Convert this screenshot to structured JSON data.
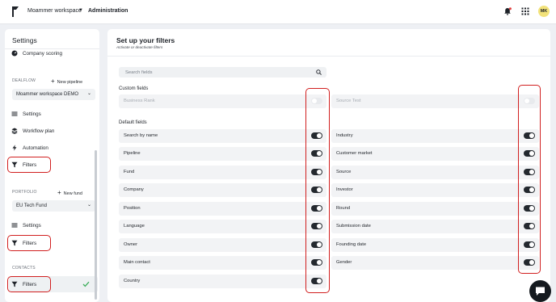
{
  "topbar": {
    "workspace": "Moammer workspace",
    "section": "Administration",
    "avatar": "MK"
  },
  "sidebar": {
    "title": "Settings",
    "company_scoring": "Company scoring",
    "dealflow_label": "DEALFLOW",
    "new_pipeline": "New pipeline",
    "pipeline_select": "Moammer workspace DEMO",
    "pipeline_items": [
      "Settings",
      "Workflow plan",
      "Automation",
      "Filters"
    ],
    "portfolio_label": "PORTFOLIO",
    "new_fund": "New fund",
    "fund_select": "EU Tech Fund",
    "portfolio_items": [
      "Settings",
      "Filters"
    ],
    "contacts_label": "CONTACTS",
    "contacts_filters": "Filters"
  },
  "main": {
    "title": "Set up your filters",
    "subtitle": "Activate or deactivate filters",
    "search_placeholder": "Search fields",
    "custom_label": "Custom fields",
    "default_label": "Default fields",
    "custom_fields": [
      {
        "label": "Business Rank",
        "enabled": false
      },
      {
        "label": "Source Test",
        "enabled": false
      }
    ],
    "default_left": [
      {
        "label": "Search by name",
        "enabled": true
      },
      {
        "label": "Pipeline",
        "enabled": true
      },
      {
        "label": "Fund",
        "enabled": true
      },
      {
        "label": "Company",
        "enabled": true
      },
      {
        "label": "Position",
        "enabled": true
      },
      {
        "label": "Language",
        "enabled": true
      },
      {
        "label": "Owner",
        "enabled": true
      },
      {
        "label": "Main contact",
        "enabled": true
      },
      {
        "label": "Country",
        "enabled": true
      }
    ],
    "default_right": [
      {
        "label": "Industry",
        "enabled": true
      },
      {
        "label": "Customer market",
        "enabled": true
      },
      {
        "label": "Source",
        "enabled": true
      },
      {
        "label": "Investor",
        "enabled": true
      },
      {
        "label": "Round",
        "enabled": true
      },
      {
        "label": "Submission date",
        "enabled": true
      },
      {
        "label": "Founding date",
        "enabled": true
      },
      {
        "label": "Gender",
        "enabled": true
      }
    ]
  },
  "colors": {
    "accent_dark": "#24292f",
    "highlight": "#d11f1f",
    "check": "#3cae5a",
    "avatar_bg": "#f2e27a"
  },
  "icons": [
    "logo-icon",
    "chevron-down-icon",
    "bell-icon",
    "apps-grid-icon",
    "gauge-icon",
    "plus-icon",
    "gear-icon",
    "layers-icon",
    "bolt-icon",
    "filter-icon",
    "check-icon",
    "search-icon",
    "chat-icon"
  ]
}
